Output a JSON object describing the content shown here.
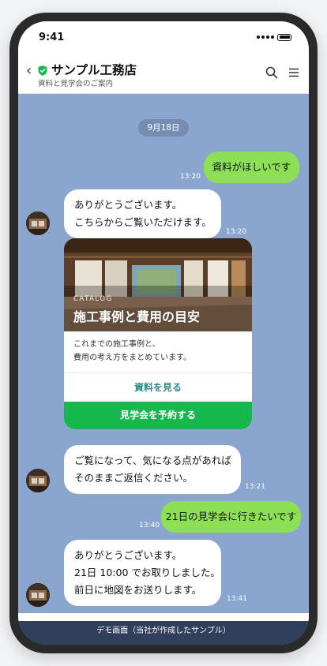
{
  "status": {
    "time": "9:41"
  },
  "header": {
    "title": "サンプル工務店",
    "subtitle": "資料と見学会のご案内",
    "back_icon": "chevron-left-icon",
    "verified_icon": "shield-check-icon"
  },
  "chat": {
    "date_label": "9月18日",
    "messages": [
      {
        "from": "me",
        "lines": [
          "資料がほしいです"
        ],
        "time": "13:20"
      },
      {
        "from": "them",
        "lines": [
          "ありがとうございます。",
          "こちらからご覧いただけます。"
        ],
        "time": "13:20"
      },
      {
        "from": "them",
        "lines": [
          "ご覧になって、気になる点があれば",
          "そのままご返信ください。"
        ],
        "time": "13:21"
      },
      {
        "from": "me",
        "lines": [
          "21日の見学会に行きたいです"
        ],
        "time": "13:40"
      },
      {
        "from": "them",
        "lines": [
          "ありがとうございます。",
          "21日 10:00 でお取りしました。",
          "前日に地図をお送りします。"
        ],
        "time": "13:41"
      }
    ],
    "card": {
      "eyebrow": "CATALOG",
      "title": "施工事例と費用の目安",
      "body_lines": [
        "これまでの施工事例と、",
        "費用の考え方をまとめています。"
      ],
      "link_label": "資料を見る",
      "cta_label": "見学会を予約する"
    }
  },
  "footer": {
    "note": "デモ画面（当社が作成したサンプル）"
  },
  "colors": {
    "chat_bg": "#8aa6cf",
    "my_bubble": "#8de055",
    "cta": "#16b84e",
    "footer": "#2f3f5c"
  }
}
